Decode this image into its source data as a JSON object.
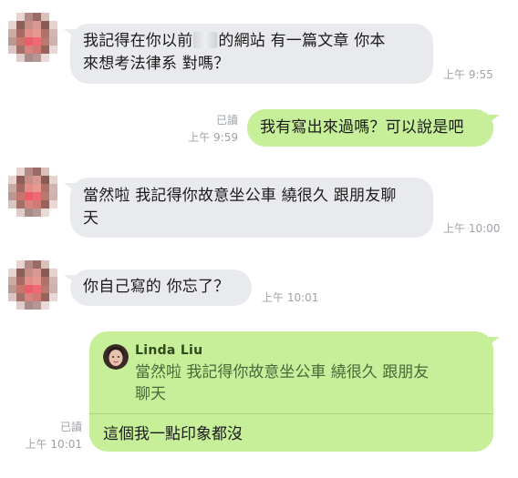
{
  "messages": [
    {
      "line1_pre": "我記得在你以前",
      "line1_post": "的網站 有一篇文章 你本",
      "line2": "來想考法律系 對嗎？",
      "time": "上午 9:55"
    },
    {
      "text": "我有寫出來過嗎？可以說是吧",
      "read": "已讀",
      "time": "上午 9:59"
    },
    {
      "line1": "當然啦 我記得你故意坐公車 繞很久 跟朋友聊",
      "line2": "天",
      "time": "上午 10:00"
    },
    {
      "text": "你自己寫的 你忘了？",
      "time": "上午 10:01"
    },
    {
      "quote_name": "Linda Liu",
      "quote_line1": "當然啦 我記得你故意坐公車 繞很久 跟朋友",
      "quote_line2": "聊天",
      "text": "這個我一點印象都沒",
      "read": "已讀",
      "time": "上午 10:01"
    }
  ],
  "colors": {
    "incoming_bubble": "#e9eaed",
    "outgoing_bubble": "#c7ee99",
    "meta_text": "#9ea3a8"
  }
}
